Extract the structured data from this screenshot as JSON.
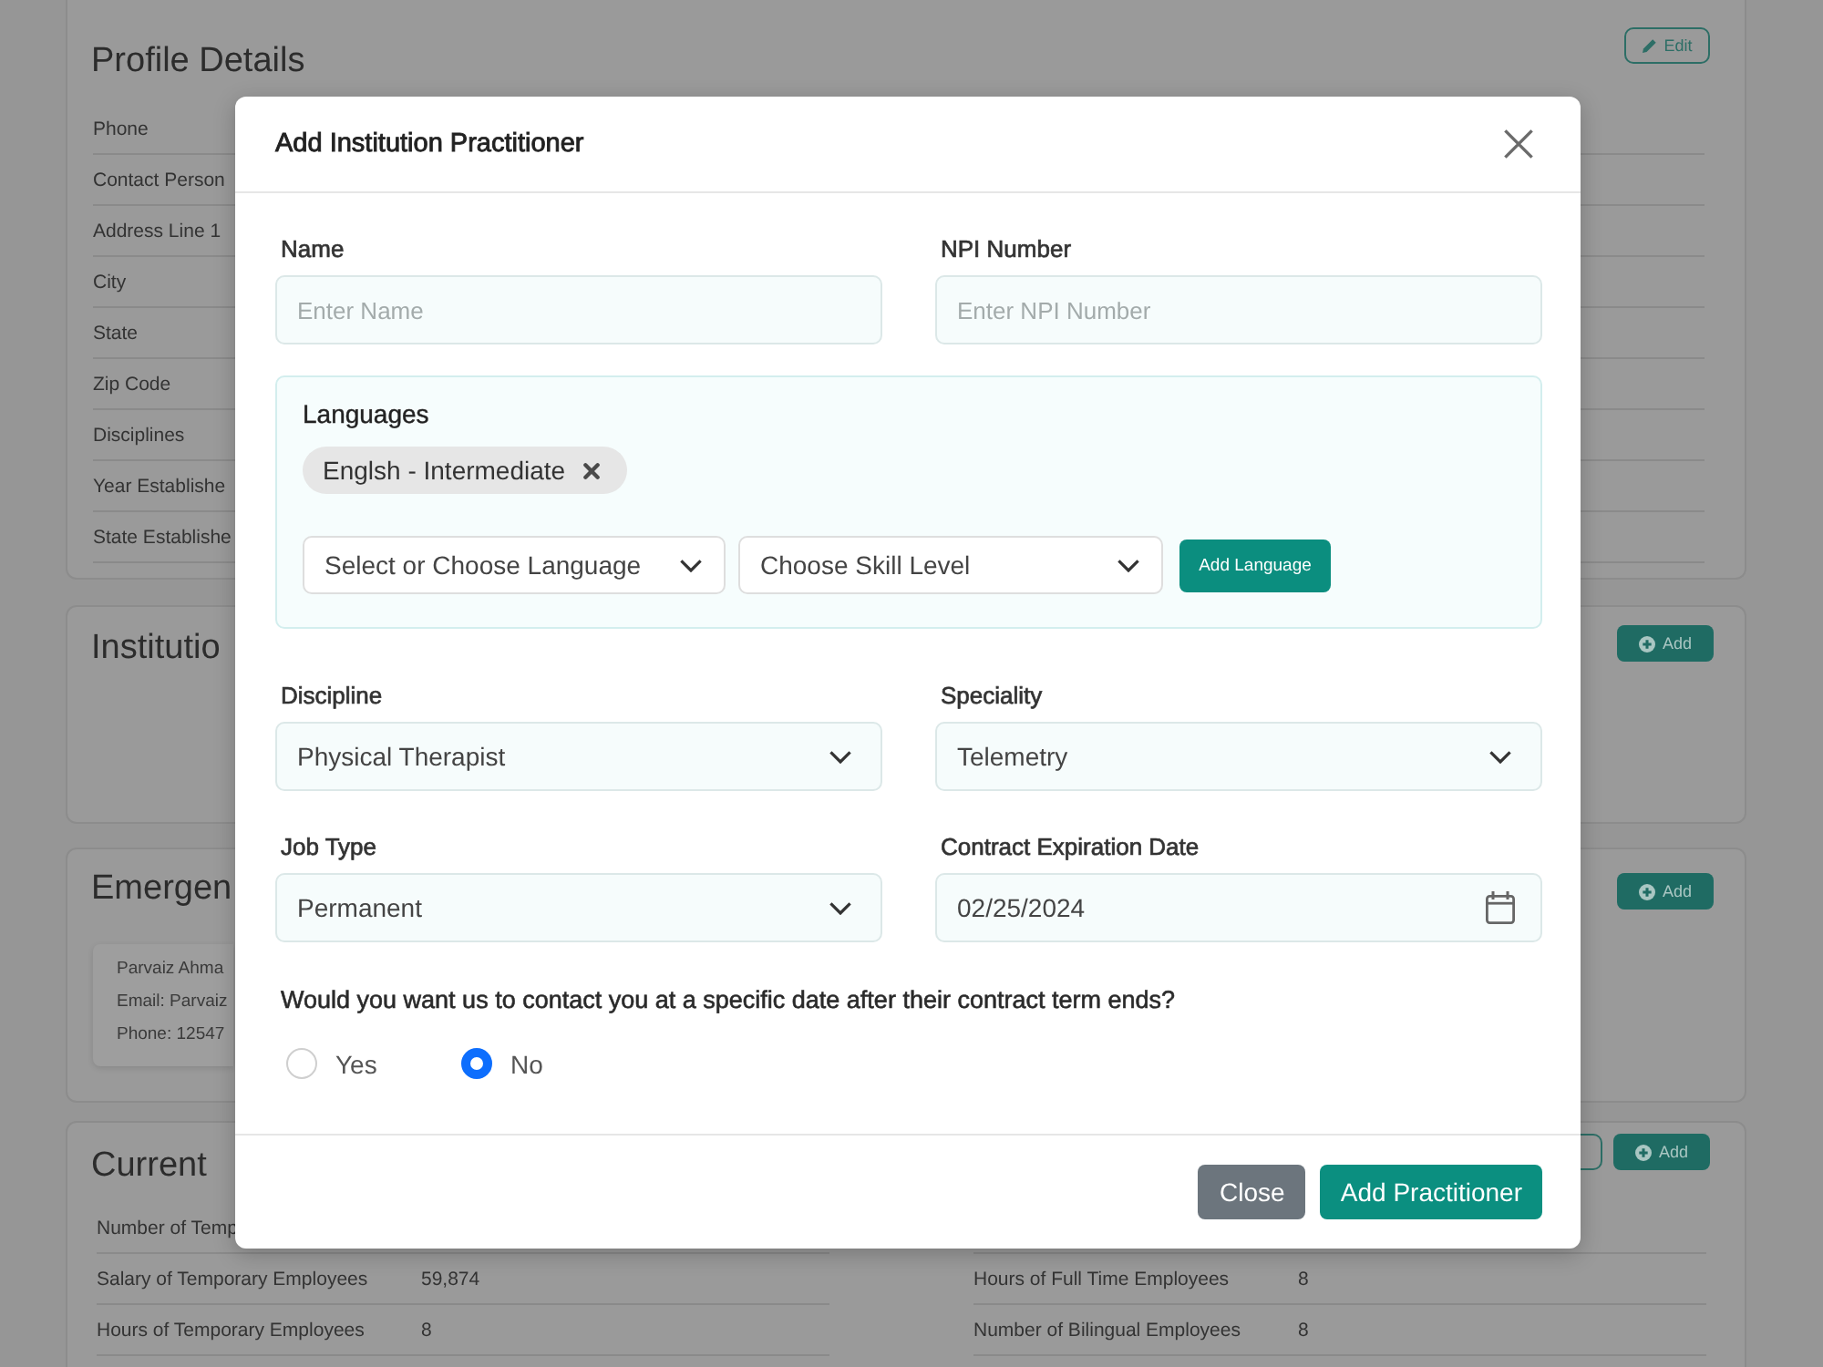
{
  "background": {
    "profile_card": {
      "title": "Profile Details",
      "edit_button": "Edit",
      "rows": [
        "Phone",
        "Contact Person",
        "Address Line 1",
        "City",
        "State",
        "Zip Code",
        "Disciplines",
        "Year Establishe",
        "State Establishe"
      ]
    },
    "institution_card": {
      "title": "Institutio",
      "add_button": "Add"
    },
    "emergency_card": {
      "title": "Emergen",
      "add_button": "Add",
      "contact": [
        "Parvaiz Ahma",
        "Email: Parvaiz",
        "Phone: 12547"
      ]
    },
    "current_card": {
      "title": "Current",
      "add_button": "Add",
      "left_rows": [
        {
          "label": "Number of Temp"
        },
        {
          "label": "Salary of Temporary Employees",
          "value": "59,874"
        },
        {
          "label": "Hours of Temporary Employees",
          "value": "8"
        }
      ],
      "right_rows": [
        {
          "label": "Hours of Full Time Employees",
          "value": "8"
        },
        {
          "label": "Number of Bilingual Employees",
          "value": "8"
        }
      ]
    }
  },
  "modal": {
    "title": "Add Institution Practitioner",
    "fields": [
      {
        "kind": "text",
        "label": "Name",
        "placeholder": "Enter Name"
      },
      {
        "kind": "text",
        "label": "NPI Number",
        "placeholder": "Enter NPI Number"
      }
    ],
    "languages": {
      "label": "Languages",
      "chips": [
        "Englsh - Intermediate"
      ],
      "selects": [
        {
          "placeholder": "Select or Choose Language"
        },
        {
          "placeholder": "Choose Skill Level"
        }
      ],
      "add_button": "Add Language"
    },
    "details": [
      {
        "kind": "select",
        "label": "Discipline",
        "value": "Physical Therapist"
      },
      {
        "kind": "select",
        "label": "Speciality",
        "value": "Telemetry"
      },
      {
        "kind": "select",
        "label": "Job Type",
        "value": "Permanent"
      },
      {
        "kind": "date",
        "label": "Contract Expiration Date",
        "value": "02/25/2024"
      }
    ],
    "question": {
      "text": "Would you want us to contact you at a specific date after their contract term ends?",
      "options": [
        {
          "label": "Yes",
          "selected": false
        },
        {
          "label": "No",
          "selected": true
        }
      ]
    },
    "buttons": [
      {
        "kind": "secondary",
        "label": "Close"
      },
      {
        "kind": "primary",
        "label": "Add Practitioner"
      }
    ]
  }
}
